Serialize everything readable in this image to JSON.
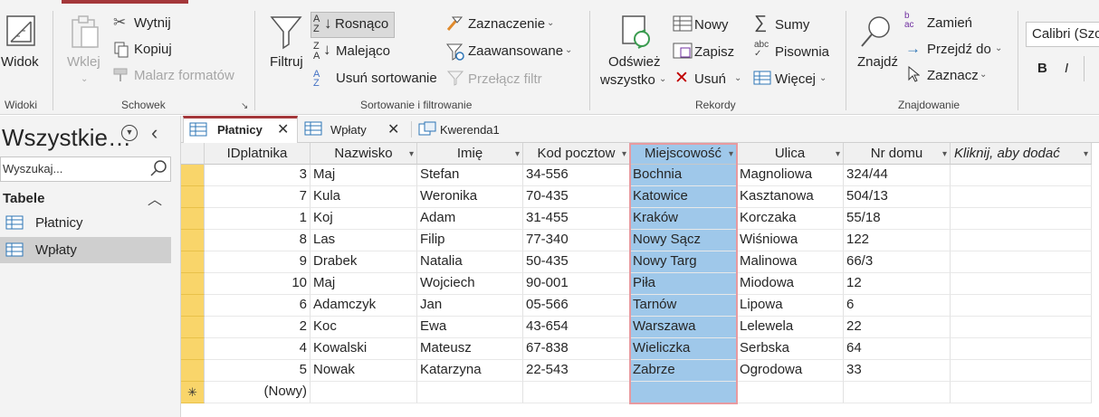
{
  "ribbon": {
    "widoki": {
      "button": "Widok",
      "group": "Widoki"
    },
    "schowek": {
      "paste": "Wklej",
      "cut": "Wytnij",
      "copy": "Kopiuj",
      "painter": "Malarz formatów",
      "group": "Schowek"
    },
    "sort": {
      "filter": "Filtruj",
      "asc": "Rosnąco",
      "desc": "Malejąco",
      "remove": "Usuń sortowanie",
      "selection": "Zaznaczenie",
      "advanced": "Zaawansowane",
      "toggle": "Przełącz filtr",
      "group": "Sortowanie i filtrowanie"
    },
    "rekordy": {
      "refresh_line1": "Odśwież",
      "refresh_line2": "wszystko",
      "new": "Nowy",
      "save": "Zapisz",
      "delete": "Usuń",
      "totals": "Sumy",
      "spelling": "Pisownia",
      "more": "Więcej",
      "group": "Rekordy"
    },
    "znajdowanie": {
      "find": "Znajdź",
      "replace": "Zamień",
      "goto": "Przejdź do",
      "select": "Zaznacz",
      "group": "Znajdowanie"
    },
    "font": {
      "name": "Calibri (Szczegóły)",
      "bold": "B",
      "italic": "I"
    }
  },
  "nav": {
    "title": "Wszystkie…",
    "search_placeholder": "Wyszukaj...",
    "section": "Tabele",
    "items": [
      {
        "label": "Płatnicy"
      },
      {
        "label": "Wpłaty"
      }
    ]
  },
  "tabs": [
    {
      "label": "Płatnicy",
      "active": true
    },
    {
      "label": "Wpłaty",
      "active": false
    },
    {
      "label": "Kwerenda1",
      "active": false
    }
  ],
  "table": {
    "columns": [
      "IDplatnika",
      "Nazwisko",
      "Imię",
      "Kod pocztow",
      "Miejscowość",
      "Ulica",
      "Nr domu",
      "Kliknij, aby dodać"
    ],
    "rows": [
      [
        "3",
        "Maj",
        "Stefan",
        "34-556",
        "Bochnia",
        "Magnoliowa",
        "324/44"
      ],
      [
        "7",
        "Kula",
        "Weronika",
        "70-435",
        "Katowice",
        "Kasztanowa",
        "504/13"
      ],
      [
        "1",
        "Koj",
        "Adam",
        "31-455",
        "Kraków",
        "Korczaka",
        "55/18"
      ],
      [
        "8",
        "Las",
        "Filip",
        "77-340",
        "Nowy Sącz",
        "Wiśniowa",
        "122"
      ],
      [
        "9",
        "Drabek",
        "Natalia",
        "50-435",
        "Nowy Targ",
        "Malinowa",
        "66/3"
      ],
      [
        "10",
        "Maj",
        "Wojciech",
        "90-001",
        "Piła",
        "Miodowa",
        "12"
      ],
      [
        "6",
        "Adamczyk",
        "Jan",
        "05-566",
        "Tarnów",
        "Lipowa",
        "6"
      ],
      [
        "2",
        "Koc",
        "Ewa",
        "43-654",
        "Warszawa",
        "Lelewela",
        "22"
      ],
      [
        "4",
        "Kowalski",
        "Mateusz",
        "67-838",
        "Wieliczka",
        "Serbska",
        "64"
      ],
      [
        "5",
        "Nowak",
        "Katarzyna",
        "22-543",
        "Zabrze",
        "Ogrodowa",
        "33"
      ]
    ],
    "new_row_label": "(Nowy)",
    "selected_column": "Miejscowość"
  },
  "colors": {
    "accent": "#a4373a",
    "selected_col": "#9fc8ea",
    "row_selector": "#f9d56a"
  }
}
